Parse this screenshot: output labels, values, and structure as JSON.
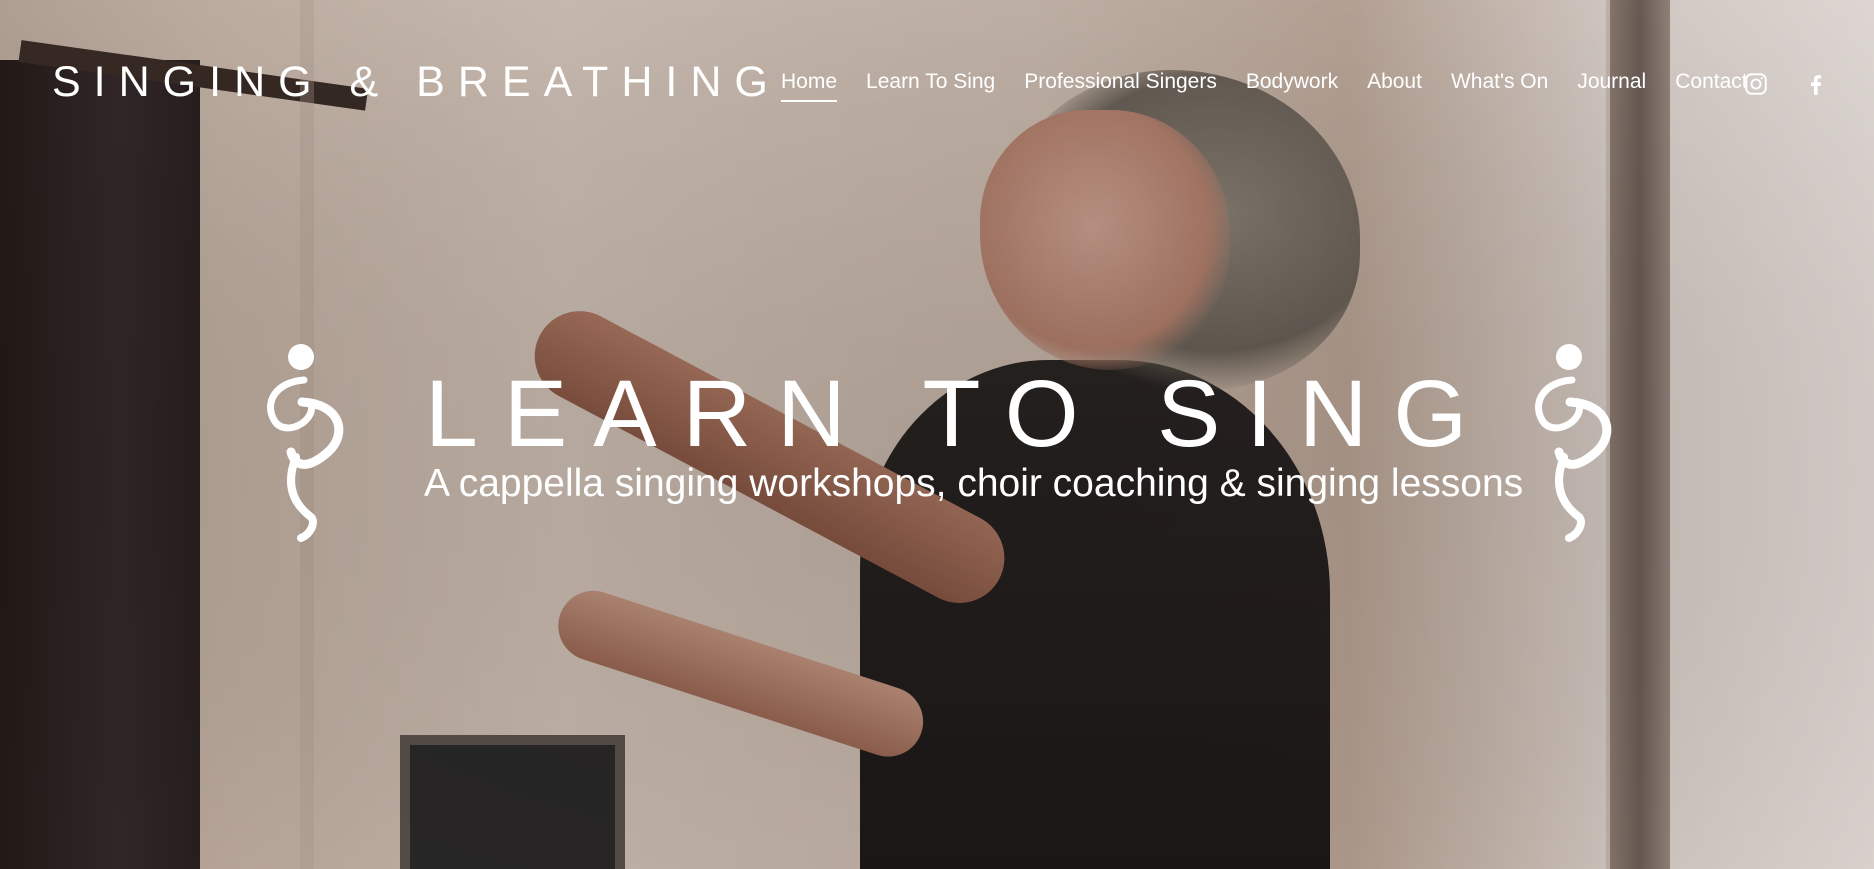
{
  "site": {
    "logo": "SINGING & BREATHING"
  },
  "nav": {
    "items": [
      {
        "label": "Home",
        "active": true
      },
      {
        "label": "Learn To Sing",
        "active": false
      },
      {
        "label": "Professional Singers",
        "active": false
      },
      {
        "label": "Bodywork",
        "active": false
      },
      {
        "label": "About",
        "active": false
      },
      {
        "label": "What's On",
        "active": false
      },
      {
        "label": "Journal",
        "active": false
      },
      {
        "label": "Contact",
        "active": false
      }
    ]
  },
  "social": {
    "icons": [
      "instagram-icon",
      "facebook-icon"
    ]
  },
  "hero": {
    "title": "LEARN TO SING",
    "subtitle": "A cappella singing workshops, choir coaching & singing lessons",
    "emblem": "singer-figure-icon"
  },
  "colors": {
    "text": "#ffffff"
  }
}
